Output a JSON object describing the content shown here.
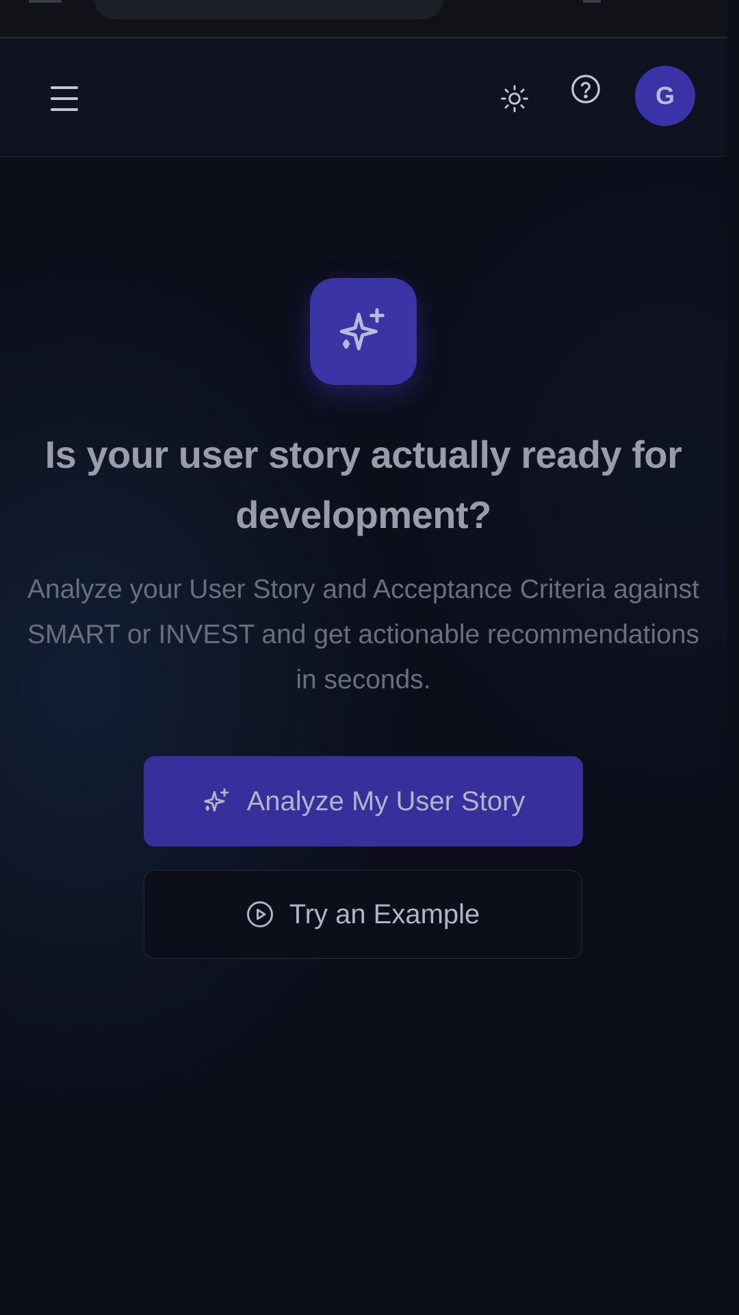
{
  "header": {
    "avatar_initial": "G",
    "icons": {
      "menu": "hamburger-menu-icon",
      "theme": "sun-icon",
      "help": "question-circle-icon"
    }
  },
  "hero": {
    "icon": "sparkles-icon",
    "title": "Is your user story actually ready for development?",
    "subtitle": "Analyze your User Story and Acceptance Criteria against SMART or INVEST and get actionable recommendations in seconds."
  },
  "actions": {
    "primary_label": "Analyze My User Story",
    "primary_icon": "sparkles-icon",
    "secondary_label": "Try an Example",
    "secondary_icon": "play-circle-icon"
  },
  "colors": {
    "background": "#0c0e1a",
    "header": "#10121f",
    "accent": "#3b34a6",
    "text_primary": "#9a9cab",
    "text_secondary": "#6b6e7f"
  }
}
